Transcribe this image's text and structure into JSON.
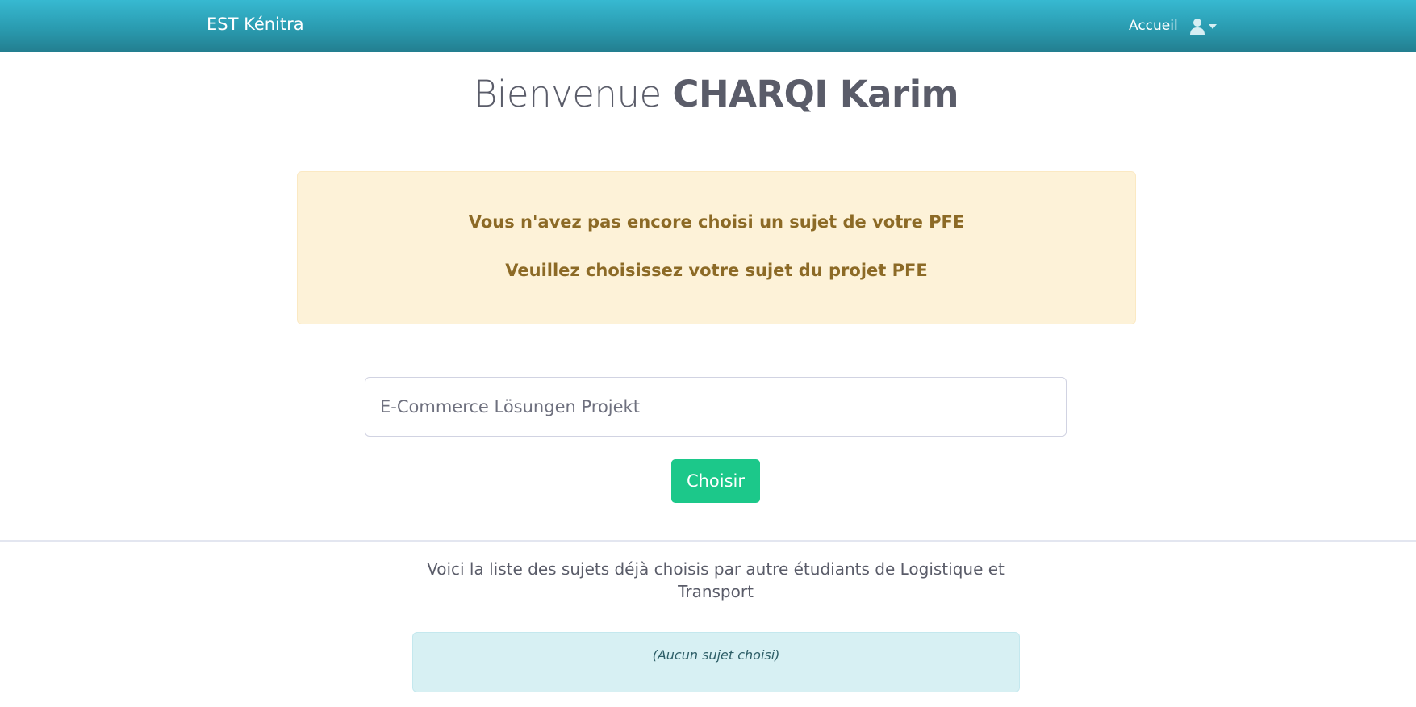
{
  "navbar": {
    "brand": "EST Kénitra",
    "home_link": "Accueil",
    "user_icon": "user-icon",
    "dropdown_icon": "caret-down-icon"
  },
  "welcome": {
    "prefix": "Bienvenue",
    "name": "CHARQI Karim"
  },
  "warning": {
    "line1": "Vous n'avez pas encore choisi un sujet de votre PFE",
    "line2": "Veuillez choisissez votre sujet du projet PFE"
  },
  "subject_form": {
    "input_value": "E-Commerce Lösungen Projekt",
    "submit_label": "Choisir"
  },
  "chosen_list": {
    "intro": "Voici la liste des sujets déjà choisis par autre étudiants de Logistique et Transport",
    "empty_message": "(Aucun sujet choisi)"
  },
  "colors": {
    "navbar": "#2a9bb0",
    "success_button": "#1cc88a",
    "warning_bg": "#fdf2d8",
    "warning_text": "#8c6a26",
    "info_bg": "#d7f0f3"
  }
}
